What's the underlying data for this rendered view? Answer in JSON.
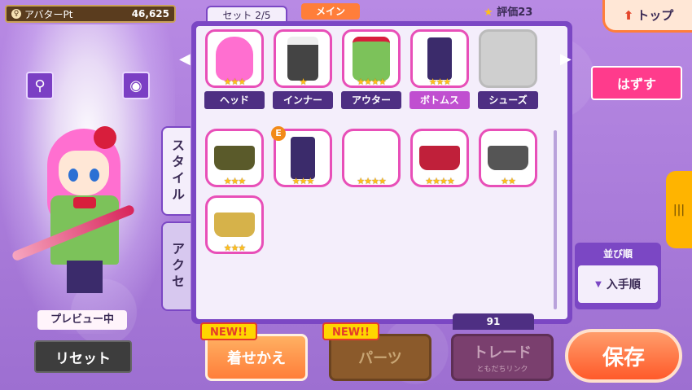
{
  "header": {
    "avatar_pt_label": "アバターPt",
    "avatar_pt_value": "46,625",
    "set_tab": "セット 2/5",
    "main_tag": "メイン",
    "rating_label": "評価23",
    "top_button": "トップ"
  },
  "left": {
    "preview_label": "プレビュー中",
    "reset_button": "リセット",
    "zoom_icon": "search-icon",
    "camera_icon": "camera-icon"
  },
  "equipped": [
    {
      "label": "ヘッド",
      "stars": "★★★",
      "icon": "hair"
    },
    {
      "label": "インナー",
      "stars": "★",
      "icon": "inner"
    },
    {
      "label": "アウター",
      "stars": "★★★★",
      "icon": "outer"
    },
    {
      "label": "ボトムス",
      "stars": "★★★",
      "icon": "pants"
    },
    {
      "label": "シューズ",
      "stars": "",
      "icon": "empty"
    }
  ],
  "side_tabs": {
    "style": "スタイル",
    "accessory": "アクセ"
  },
  "items": [
    {
      "stars": "★★★",
      "icon": "skirt",
      "color": "#5a5a2a",
      "badge": ""
    },
    {
      "stars": "★★★",
      "icon": "pants",
      "color": "#3b2b6b",
      "badge": "E"
    },
    {
      "stars": "★★★★",
      "icon": "socks",
      "color": "#ffffff",
      "badge": ""
    },
    {
      "stars": "★★★★",
      "icon": "skirt",
      "color": "#c0203a",
      "badge": ""
    },
    {
      "stars": "★★",
      "icon": "skirt",
      "color": "#555555",
      "badge": ""
    },
    {
      "stars": "★★★",
      "icon": "skirt",
      "color": "#d6b24a",
      "badge": ""
    }
  ],
  "right": {
    "remove_button": "はずす",
    "sort_title": "並び順",
    "sort_value": "入手順"
  },
  "bottom": {
    "new_badge_1": "NEW!!",
    "new_badge_2": "NEW!!",
    "dressup_button": "着せかえ",
    "parts_button": "パーツ",
    "trade_button": "トレード",
    "trade_sub": "ともだちリンク",
    "count": "91",
    "save_button": "保存"
  },
  "colors": {
    "accent_pink": "#e84fb8",
    "panel_purple": "#7b47c4",
    "orange": "#ff7e3a"
  }
}
